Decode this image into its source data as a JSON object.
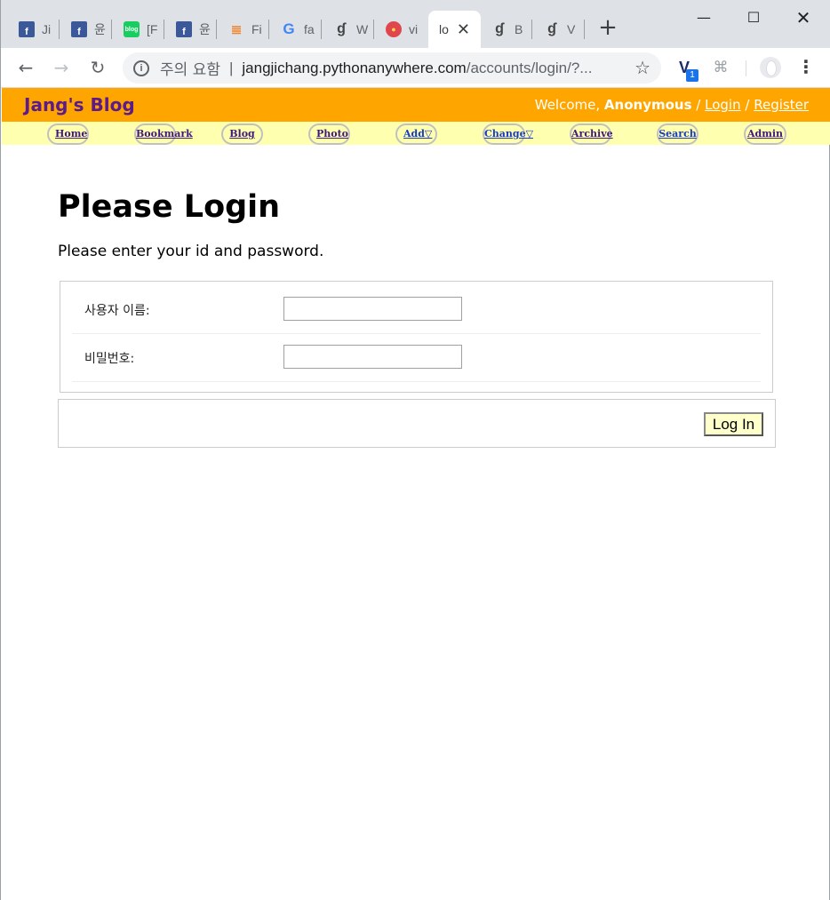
{
  "browser": {
    "tabs": [
      {
        "icon": "facebook-icon",
        "title": "Ji"
      },
      {
        "icon": "facebook-icon",
        "title": "윤"
      },
      {
        "icon": "blog-icon",
        "title": "[F"
      },
      {
        "icon": "facebook-icon",
        "title": "윤"
      },
      {
        "icon": "stackoverflow-icon",
        "title": "Fi"
      },
      {
        "icon": "google-icon",
        "title": "fa"
      },
      {
        "icon": "quill-icon",
        "title": "W"
      },
      {
        "icon": "red-circle-icon",
        "title": "vi"
      },
      {
        "icon": "none",
        "title": "lo",
        "active": true
      },
      {
        "icon": "quill-icon",
        "title": "B"
      },
      {
        "icon": "quill-icon",
        "title": "V"
      }
    ],
    "new_tab_glyph": "+",
    "security_label": "주의 요함",
    "url_host": "jangjichang.pythonanywhere.com",
    "url_path": "/accounts/login/?...",
    "ext_badge": "1"
  },
  "site": {
    "title": "Jang's Blog",
    "welcome_prefix": "Welcome,",
    "user": "Anonymous",
    "sep": "/",
    "login": "Login",
    "register": "Register",
    "menu": [
      "Home",
      "Bookmark",
      "Blog",
      "Photo",
      "Add▽",
      "Change▽",
      "Archive",
      "Search",
      "Admin"
    ]
  },
  "page": {
    "heading": "Please Login",
    "instruction": "Please enter your id and password.",
    "username_label": "사용자 이름:",
    "username_value": "",
    "password_label": "비밀번호:",
    "password_value": "",
    "submit_label": "Log In"
  },
  "colors": {
    "header_bg": "#ffa500",
    "menubar_bg": "#ffffb0",
    "title_color": "#5c1a8a"
  }
}
